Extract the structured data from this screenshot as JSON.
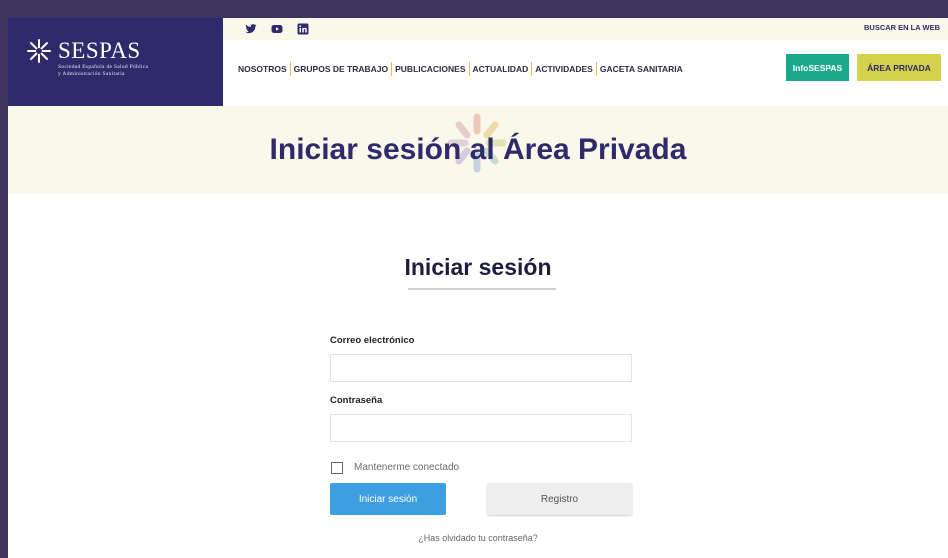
{
  "header": {
    "logo": {
      "name": "SESPAS",
      "subtitle_line1": "Sociedad Española de Salud Pública",
      "subtitle_line2": "y Administración Sanitaria"
    },
    "social_icons": [
      "twitter-icon",
      "youtube-icon",
      "linkedin-icon"
    ],
    "search_link": "BUSCAR EN LA WEB",
    "nav": [
      "NOSOTROS",
      "GRUPOS DE TRABAJO",
      "PUBLICACIONES",
      "ACTUALIDAD",
      "ACTIVIDADES",
      "GACETA SANITARIA"
    ],
    "infosespas_button": "InfoSESPAS",
    "private_area_button": "ÁREA PRIVADA"
  },
  "hero": {
    "title": "Iniciar sesión al Área Privada"
  },
  "login": {
    "title": "Iniciar sesión",
    "email_label": "Correo electrónico",
    "email_value": "",
    "password_label": "Contraseña",
    "password_value": "",
    "remember_label": "Mantenerme conectado",
    "remember_checked": false,
    "submit_label": "Iniciar sesión",
    "register_label": "Registro",
    "forgot_label": "¿Has olvidado tu contraseña?"
  },
  "colors": {
    "background": "#3d3460",
    "brand_purple": "#2f2a6b",
    "info_green": "#1ba98c",
    "private_yellow": "#d4d14a",
    "hero_bg": "#faf8ea",
    "login_blue": "#3d9ee0"
  }
}
